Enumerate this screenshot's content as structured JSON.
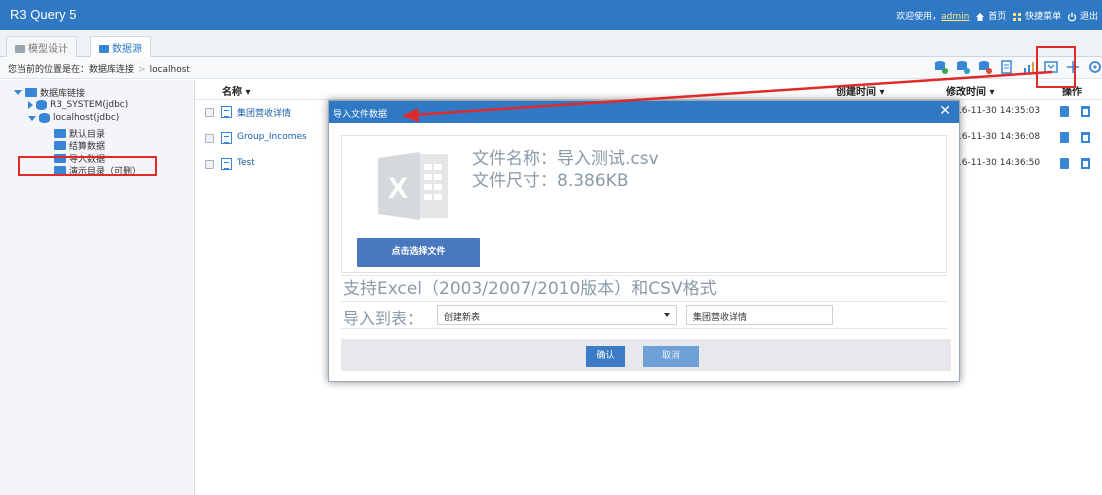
{
  "app": {
    "title": "R3 Query 5"
  },
  "header": {
    "welcome": "欢迎使用，",
    "user": "admin",
    "home": "首页",
    "quick_menu": "快捷菜单",
    "logout": "退出"
  },
  "tabs": [
    {
      "label": "模型设计"
    },
    {
      "label": "数据源"
    }
  ],
  "location": {
    "prefix": "您当前的位置是在：数据库连接",
    "current": "localhost"
  },
  "tree": {
    "root": "数据库链接",
    "r3_system": "R3_SYSTEM(jdbc)",
    "localhost": "localhost(jdbc)",
    "children": [
      "默认目录",
      "结算数据",
      "导入数据",
      "演示目录（可删）"
    ]
  },
  "table": {
    "headers": {
      "name": "名称 ▾",
      "created": "创建时间 ▾",
      "modified": "修改时间 ▾",
      "actions": "操作"
    },
    "rows": [
      {
        "name": "集团营收详情",
        "modified": "16-11-30 14:35:03"
      },
      {
        "name": "Group_Incomes",
        "modified": "16-11-30 14:36:08"
      },
      {
        "name": "Test",
        "modified": "16-11-30 14:36:50"
      }
    ]
  },
  "modal": {
    "title": "导入文件数据",
    "close": "✕",
    "file_name": "文件名称：导入测试.csv",
    "file_size": "文件尺寸：8.386KB",
    "choose_button": "点击选择文件",
    "support_text": "支持Excel（2003/2007/2010版本）和CSV格式",
    "import_label": "导入到表：",
    "table_select": "创建新表",
    "table_name": "集团营收详情",
    "ok": "确认",
    "cancel": "取消"
  },
  "colors": {
    "primary": "#2f78c4",
    "annotation": "#e02a2a"
  }
}
